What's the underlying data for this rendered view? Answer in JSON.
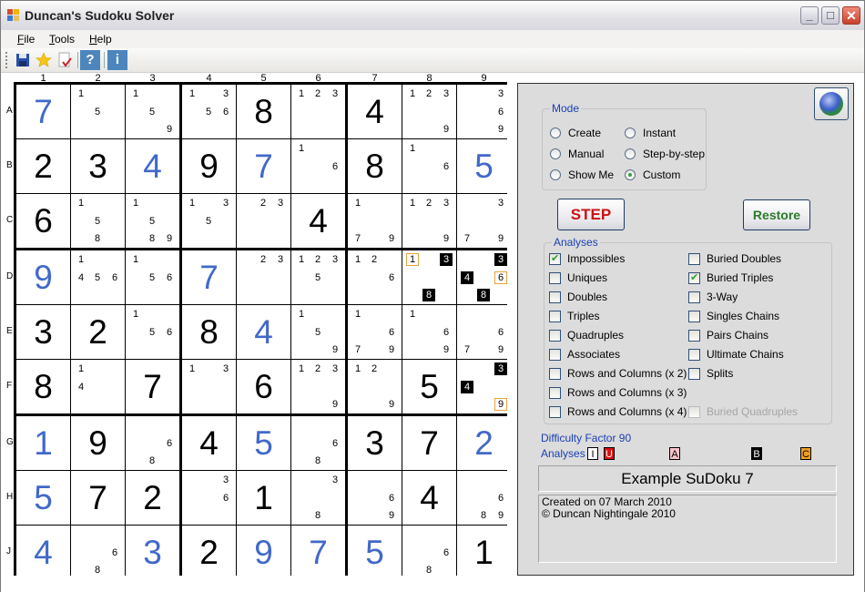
{
  "window": {
    "title": "Duncan's Sudoku Solver",
    "controls": {
      "minimize": "_",
      "maximize": "□",
      "close": "✕"
    }
  },
  "menu": [
    {
      "label": "File",
      "accel": "F"
    },
    {
      "label": "Tools",
      "accel": "T"
    },
    {
      "label": "Help",
      "accel": "H"
    }
  ],
  "toolbar": {
    "buttons": [
      {
        "name": "save",
        "icon": "floppy-disk-icon"
      },
      {
        "name": "new",
        "icon": "star-icon"
      },
      {
        "name": "check",
        "icon": "document-check-icon"
      },
      {
        "name": "help",
        "label": "?"
      },
      {
        "name": "about",
        "label": "i"
      }
    ]
  },
  "board": {
    "column_labels": [
      "1",
      "2",
      "3",
      "4",
      "5",
      "6",
      "7",
      "8",
      "9"
    ],
    "row_labels": [
      "A",
      "B",
      "C",
      "D",
      "E",
      "F",
      "G",
      "H",
      "J"
    ],
    "colors": {
      "given": "#000000",
      "solved": "#4169c9",
      "highlight_black": "#000000",
      "highlight_orange": "#e7a33e"
    },
    "rows": [
      [
        {
          "v": "7",
          "t": "solved"
        },
        {
          "c": [
            1,
            5
          ]
        },
        {
          "c": [
            1,
            5,
            9
          ]
        },
        {
          "c": [
            1,
            3,
            5,
            6
          ]
        },
        {
          "v": "8",
          "t": "given"
        },
        {
          "c": [
            1,
            2,
            3
          ]
        },
        {
          "v": "4",
          "t": "given"
        },
        {
          "c": [
            1,
            2,
            3,
            9
          ]
        },
        {
          "c": [
            3,
            6,
            9
          ]
        }
      ],
      [
        {
          "v": "2",
          "t": "given"
        },
        {
          "v": "3",
          "t": "given"
        },
        {
          "v": "4",
          "t": "solved"
        },
        {
          "v": "9",
          "t": "given"
        },
        {
          "v": "7",
          "t": "solved"
        },
        {
          "c": [
            1,
            6
          ]
        },
        {
          "v": "8",
          "t": "given"
        },
        {
          "c": [
            1,
            6
          ]
        },
        {
          "v": "5",
          "t": "solved"
        }
      ],
      [
        {
          "v": "6",
          "t": "given"
        },
        {
          "c": [
            1,
            5,
            8
          ]
        },
        {
          "c": [
            1,
            5,
            8,
            9
          ]
        },
        {
          "c": [
            1,
            3,
            5
          ]
        },
        {
          "c": [
            2,
            3
          ]
        },
        {
          "v": "4",
          "t": "given"
        },
        {
          "c": [
            1,
            7,
            9
          ]
        },
        {
          "c": [
            1,
            2,
            3,
            9
          ]
        },
        {
          "c": [
            3,
            7,
            9
          ]
        }
      ],
      [
        {
          "v": "9",
          "t": "solved"
        },
        {
          "c": [
            1,
            4,
            5,
            6
          ]
        },
        {
          "c": [
            1,
            5,
            6
          ]
        },
        {
          "v": "7",
          "t": "solved"
        },
        {
          "c": [
            2,
            3
          ]
        },
        {
          "c": [
            1,
            2,
            3,
            5
          ]
        },
        {
          "c": [
            1,
            2,
            6
          ]
        },
        {
          "c": [
            1,
            3,
            8
          ],
          "hb": [
            3,
            8
          ],
          "ho": [
            1
          ]
        },
        {
          "c": [
            3,
            4,
            6,
            8
          ],
          "hb": [
            3,
            4,
            8
          ],
          "ho": [
            6
          ]
        }
      ],
      [
        {
          "v": "3",
          "t": "given"
        },
        {
          "v": "2",
          "t": "given"
        },
        {
          "c": [
            1,
            5,
            6
          ]
        },
        {
          "v": "8",
          "t": "given"
        },
        {
          "v": "4",
          "t": "solved"
        },
        {
          "c": [
            1,
            5,
            9
          ]
        },
        {
          "c": [
            1,
            6,
            7,
            9
          ]
        },
        {
          "c": [
            1,
            6,
            9
          ]
        },
        {
          "c": [
            6,
            7,
            9
          ]
        }
      ],
      [
        {
          "v": "8",
          "t": "given"
        },
        {
          "c": [
            1,
            4
          ]
        },
        {
          "v": "7",
          "t": "given"
        },
        {
          "c": [
            1,
            3
          ]
        },
        {
          "v": "6",
          "t": "given"
        },
        {
          "c": [
            1,
            2,
            3,
            9
          ]
        },
        {
          "c": [
            1,
            2,
            9
          ]
        },
        {
          "v": "5",
          "t": "given"
        },
        {
          "c": [
            3,
            4,
            9
          ],
          "hb": [
            3,
            4
          ],
          "ho": [
            9
          ]
        }
      ],
      [
        {
          "v": "1",
          "t": "solved"
        },
        {
          "v": "9",
          "t": "given"
        },
        {
          "c": [
            6,
            8
          ]
        },
        {
          "v": "4",
          "t": "given"
        },
        {
          "v": "5",
          "t": "solved"
        },
        {
          "c": [
            6,
            8
          ]
        },
        {
          "v": "3",
          "t": "given"
        },
        {
          "v": "7",
          "t": "given"
        },
        {
          "v": "2",
          "t": "solved"
        }
      ],
      [
        {
          "v": "5",
          "t": "solved"
        },
        {
          "v": "7",
          "t": "given"
        },
        {
          "v": "2",
          "t": "given"
        },
        {
          "c": [
            3,
            6
          ]
        },
        {
          "v": "1",
          "t": "given"
        },
        {
          "c": [
            3,
            8
          ]
        },
        {
          "c": [
            6,
            9
          ]
        },
        {
          "v": "4",
          "t": "given"
        },
        {
          "c": [
            6,
            8,
            9
          ]
        }
      ],
      [
        {
          "v": "4",
          "t": "solved"
        },
        {
          "c": [
            6,
            8
          ]
        },
        {
          "v": "3",
          "t": "solved"
        },
        {
          "v": "2",
          "t": "given"
        },
        {
          "v": "9",
          "t": "solved"
        },
        {
          "v": "7",
          "t": "solved"
        },
        {
          "v": "5",
          "t": "solved"
        },
        {
          "c": [
            6,
            8
          ]
        },
        {
          "v": "1",
          "t": "given"
        }
      ]
    ]
  },
  "panel": {
    "globe_button": "globe-icon",
    "mode": {
      "title": "Mode",
      "options": [
        {
          "label": "Create",
          "checked": false
        },
        {
          "label": "Manual",
          "checked": false
        },
        {
          "label": "Show Me",
          "checked": false
        },
        {
          "label": "Instant",
          "checked": false
        },
        {
          "label": "Step-by-step",
          "checked": false
        },
        {
          "label": "Custom",
          "checked": true
        }
      ]
    },
    "step_label": "STEP",
    "restore_label": "Restore",
    "analyses": {
      "title": "Analyses",
      "left": [
        {
          "label": "Impossibles",
          "checked": true
        },
        {
          "label": "Uniques",
          "checked": false
        },
        {
          "label": "Doubles",
          "checked": false
        },
        {
          "label": "Triples",
          "checked": false
        },
        {
          "label": "Quadruples",
          "checked": false
        },
        {
          "label": "Associates",
          "checked": false
        },
        {
          "label": "Rows and Columns (x 2)",
          "checked": false
        },
        {
          "label": "Rows and Columns (x 3)",
          "checked": false
        },
        {
          "label": "Rows and Columns (x 4)",
          "checked": false
        }
      ],
      "right": [
        {
          "label": "Buried Doubles",
          "checked": false
        },
        {
          "label": "Buried Triples",
          "checked": true
        },
        {
          "label": "3-Way",
          "checked": false
        },
        {
          "label": "Singles Chains",
          "checked": false
        },
        {
          "label": "Pairs Chains",
          "checked": false
        },
        {
          "label": "Ultimate Chains",
          "checked": false
        },
        {
          "label": "Splits",
          "checked": false
        },
        {
          "label": "Buried Quadruples",
          "checked": false,
          "disabled": true
        }
      ]
    },
    "difficulty": "Difficulty Factor 90",
    "analyses_label": "Analyses",
    "badges": [
      {
        "letter": "I",
        "bg": "#ffffff",
        "fg": "#000000"
      },
      {
        "letter": "U",
        "bg": "#dd1111",
        "fg": "#ffffff"
      },
      {
        "letter": "A",
        "bg": "#f7c4cc",
        "fg": "#000000"
      },
      {
        "letter": "B",
        "bg": "#000000",
        "fg": "#ffffff"
      },
      {
        "letter": "C",
        "bg": "#f2a01a",
        "fg": "#000000"
      }
    ],
    "puzzle_name": "Example SuDoku 7",
    "notes": [
      "Created on 07 March 2010",
      "© Duncan Nightingale 2010"
    ]
  }
}
